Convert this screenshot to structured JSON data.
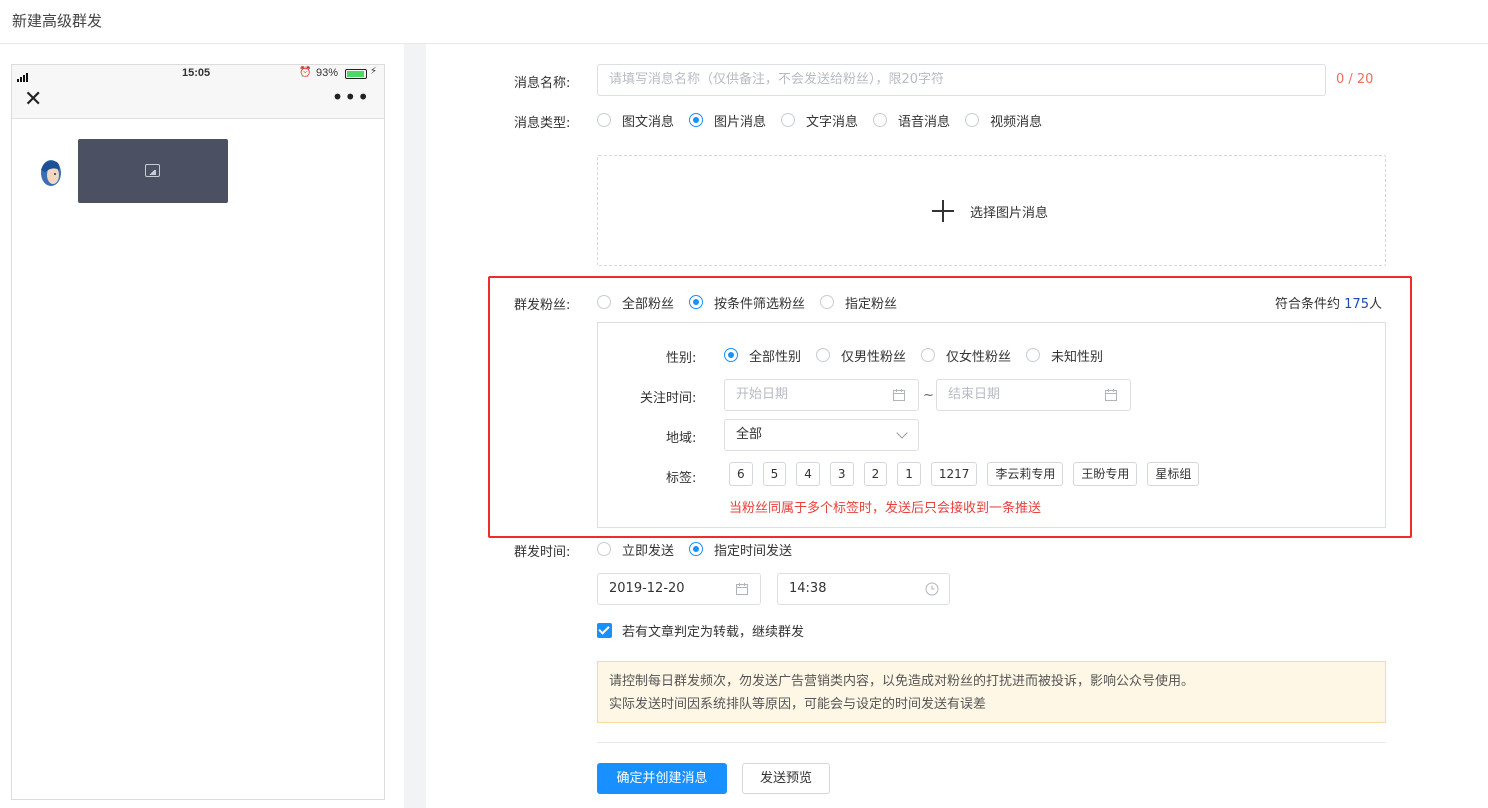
{
  "page": {
    "title": "新建高级群发"
  },
  "preview": {
    "status": {
      "time": "15:05",
      "battery_pct": "93%",
      "battery_level": 0.93
    },
    "close_icon": "close-icon",
    "more_icon": "more-dots-icon"
  },
  "form": {
    "name": {
      "label": "消息名称:",
      "placeholder": "请填写消息名称（仅供备注，不会发送给粉丝），限20字符",
      "counter": "0 / 20"
    },
    "type": {
      "label": "消息类型:",
      "options": [
        "图文消息",
        "图片消息",
        "文字消息",
        "语音消息",
        "视频消息"
      ],
      "selected": "图片消息"
    },
    "upload": {
      "label": "选择图片消息"
    },
    "audience": {
      "label": "群发粉丝:",
      "options": [
        "全部粉丝",
        "按条件筛选粉丝",
        "指定粉丝"
      ],
      "selected": "按条件筛选粉丝",
      "match_prefix": "符合条件约",
      "match_count": "175",
      "match_suffix": "人"
    },
    "filters": {
      "gender": {
        "label": "性别:",
        "options": [
          "全部性别",
          "仅男性粉丝",
          "仅女性粉丝",
          "未知性别"
        ],
        "selected": "全部性别"
      },
      "follow_time": {
        "label": "关注时间:",
        "start_placeholder": "开始日期",
        "end_placeholder": "结束日期",
        "separator": "~"
      },
      "region": {
        "label": "地域:",
        "value": "全部"
      },
      "tags": {
        "label": "标签:",
        "items": [
          "6",
          "5",
          "4",
          "3",
          "2",
          "1",
          "1217",
          "李云莉专用",
          "王盼专用",
          "星标组"
        ],
        "note": "当粉丝同属于多个标签时，发送后只会接收到一条推送"
      }
    },
    "send_time": {
      "label": "群发时间:",
      "options": [
        "立即发送",
        "指定时间发送"
      ],
      "selected": "指定时间发送",
      "date": "2019-12-20",
      "time": "14:38"
    },
    "reprint": {
      "label": "若有文章判定为转载，继续群发",
      "checked": true
    },
    "notice": {
      "line1": "请控制每日群发频次，勿发送广告营销类内容，以免造成对粉丝的打扰进而被投诉，影响公众号使用。",
      "line2": "实际发送时间因系统排队等原因，可能会与设定的时间发送有误差"
    },
    "buttons": {
      "submit": "确定并创建消息",
      "preview": "发送预览"
    }
  },
  "colors": {
    "primary": "#1890ff",
    "danger": "#f02b2b",
    "warning_bg": "#fff7e6"
  }
}
